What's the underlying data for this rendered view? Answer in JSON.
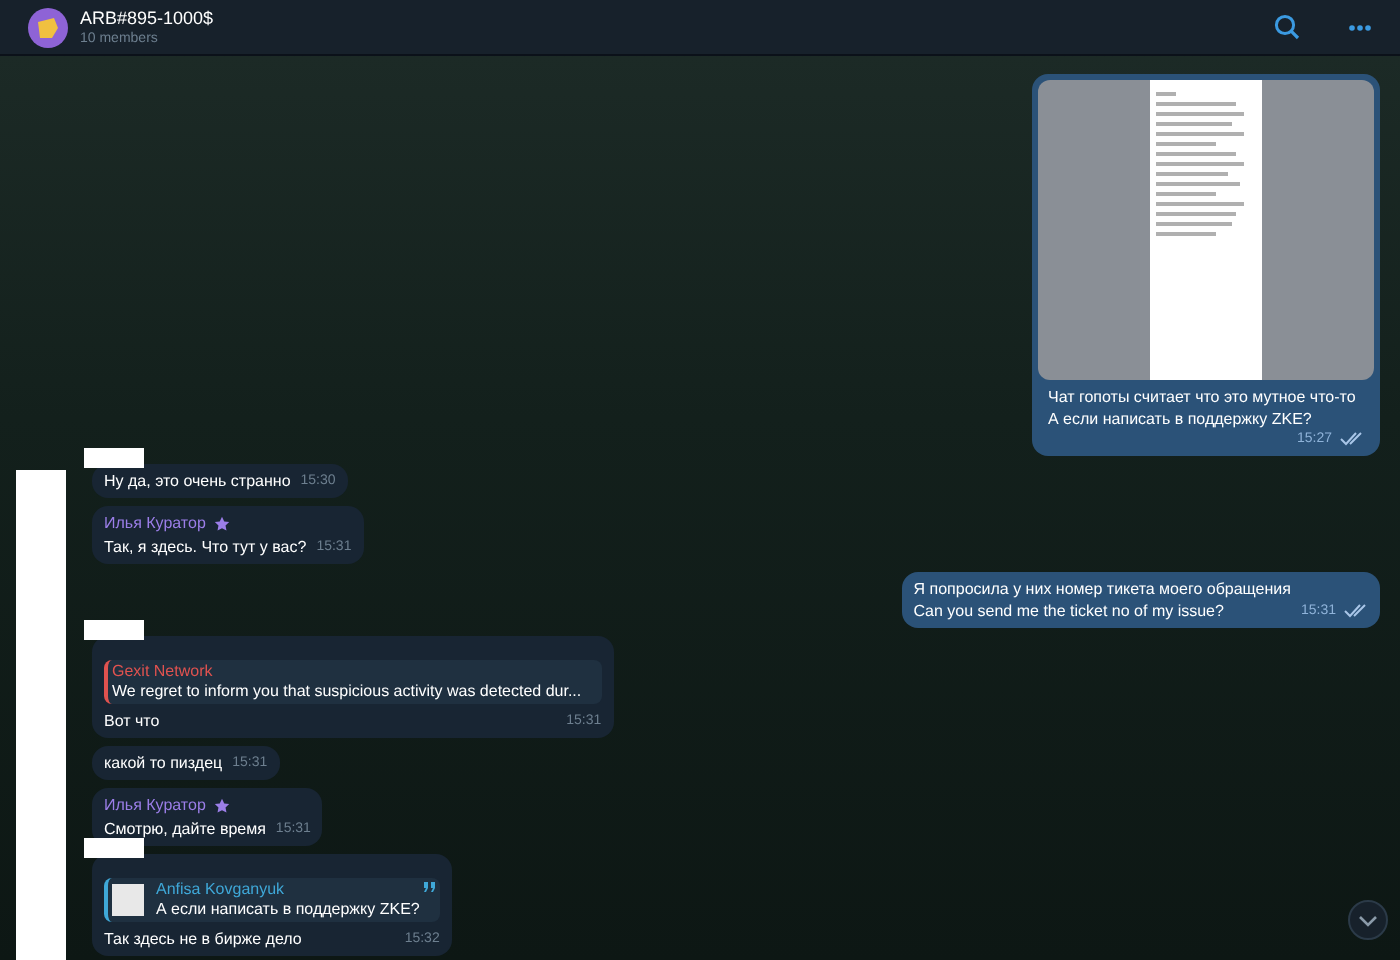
{
  "header": {
    "title": "ARB#895-1000$",
    "subtitle": "10 members"
  },
  "messages": [
    {
      "kind": "photo",
      "outgoing": true,
      "text_lines": [
        "Чат гопоты считает что это мутное что-то",
        "А если написать в поддержку ZKE?"
      ],
      "time": "15:27",
      "read": true,
      "redacted": false
    },
    {
      "kind": "text",
      "outgoing": false,
      "text": "Ну да, это очень странно",
      "time": "15:30",
      "redacted": true
    },
    {
      "kind": "text",
      "outgoing": false,
      "sender": "Илья Куратор",
      "text": "Так, я здесь. Что тут у вас?",
      "time": "15:31",
      "redacted": false
    },
    {
      "kind": "text",
      "outgoing": true,
      "text_lines": [
        "Я попросила у них номер тикета моего обращения",
        "Can you send me the ticket no of my issue?"
      ],
      "time": "15:31",
      "read": true,
      "redacted": false
    },
    {
      "kind": "reply",
      "outgoing": false,
      "reply": {
        "name": "Gexit Network",
        "text": "We regret to inform you that suspicious activity was detected dur...",
        "color": "#e0524f",
        "thumb": false
      },
      "text": "Вот что",
      "time": "15:31",
      "redacted": true
    },
    {
      "kind": "text",
      "outgoing": false,
      "text": "какой то пиздец",
      "time": "15:31",
      "redacted": false
    },
    {
      "kind": "text",
      "outgoing": false,
      "sender": "Илья Куратор",
      "text": "Смотрю, дайте время",
      "time": "15:31",
      "redacted": false
    },
    {
      "kind": "reply",
      "outgoing": false,
      "reply": {
        "name": "Anfisa Kovganyuk",
        "text": "А если написать в поддержку ZKE?",
        "color": "#3fa8d8",
        "thumb": true
      },
      "text": "Так здесь не в бирже дело",
      "time": "15:32",
      "redacted": true
    }
  ]
}
